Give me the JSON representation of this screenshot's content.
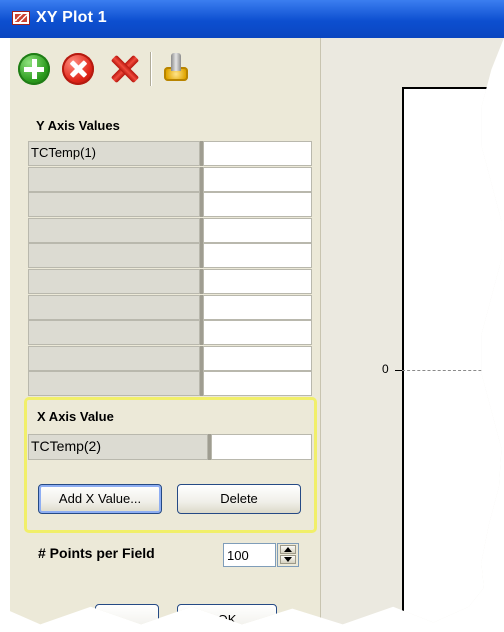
{
  "window": {
    "title": "XY Plot 1",
    "title_icon": "chart-icon",
    "titlebar_color": "#0d4fd0"
  },
  "toolbar": {
    "icons": [
      "add-icon",
      "remove-icon",
      "delete-icon",
      "settings-icon"
    ]
  },
  "y_axis": {
    "label": "Y Axis Values",
    "rows": [
      {
        "name": "TCTemp(1)",
        "value": ""
      },
      {
        "name": "",
        "value": ""
      },
      {
        "name": "",
        "value": ""
      },
      {
        "name": "",
        "value": ""
      },
      {
        "name": "",
        "value": ""
      },
      {
        "name": "",
        "value": ""
      },
      {
        "name": "",
        "value": ""
      },
      {
        "name": "",
        "value": ""
      },
      {
        "name": "",
        "value": ""
      },
      {
        "name": "",
        "value": ""
      }
    ]
  },
  "x_axis": {
    "label": "X Axis Value",
    "row": {
      "name": "TCTemp(2)",
      "value": ""
    },
    "add_button": "Add X Value...",
    "delete_button": "Delete",
    "highlight_color": "#f1ef6a"
  },
  "points": {
    "label": "# Points per Field",
    "value": "100"
  },
  "bottom_buttons": {
    "second_partial": "OK"
  },
  "plot": {
    "zero_label": "0"
  }
}
